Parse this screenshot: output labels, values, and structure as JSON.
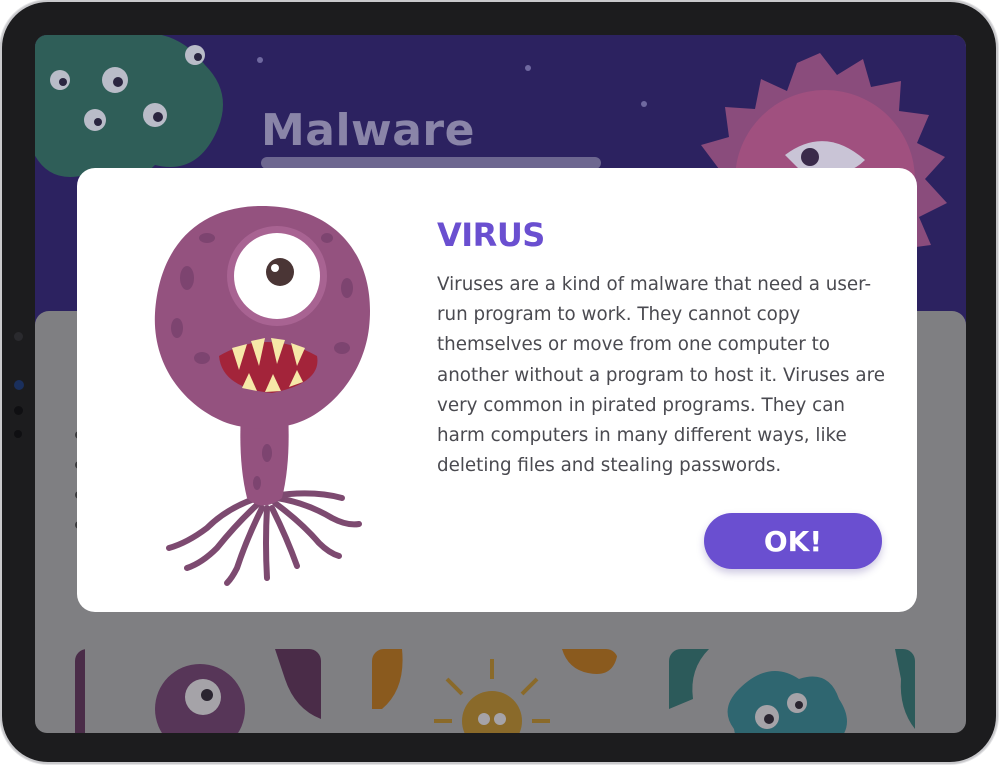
{
  "background_page": {
    "title": "Malware"
  },
  "dialog": {
    "title": "VIRUS",
    "body": "Viruses are a kind of malware that need a user-run program to work. They cannot copy themselves or move from one computer to another without a program to host it. Viruses are very common in pirated programs. They can harm computers in many different ways, like deleting files and stealing passwords.",
    "ok_label": "OK!",
    "image": "purple-one-eyed-virus-monster"
  },
  "background_cards": [
    "purple-virus-card",
    "orange-bacteria-card",
    "teal-blob-card"
  ],
  "colors": {
    "accent": "#6a4fd0",
    "header_bg": "#2c2260",
    "overlay": "#7f7f82",
    "virus_purple": "#94527f"
  }
}
